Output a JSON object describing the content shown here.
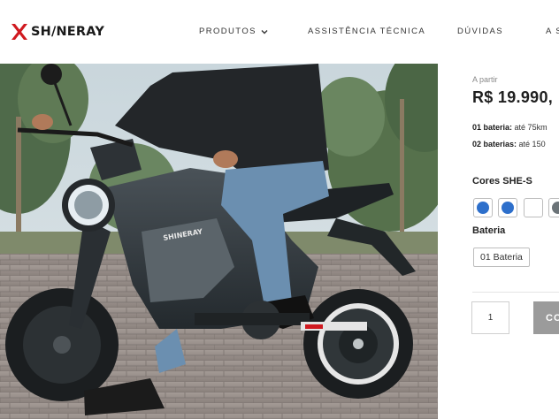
{
  "brand": {
    "logo_text": "SH/NERAY",
    "accent_color": "#d0191f"
  },
  "nav": {
    "items": [
      {
        "label": "PRODUTOS",
        "has_dropdown": true
      },
      {
        "label": "ASSISTÊNCIA TÉCNICA",
        "has_dropdown": false
      },
      {
        "label": "DÚVIDAS",
        "has_dropdown": false
      },
      {
        "label": "A S",
        "has_dropdown": false
      }
    ]
  },
  "hero": {
    "image_subject": "rider on SHINERAY SHE-S electric motorcycle",
    "bike_brand_text": "SHINERAY"
  },
  "product": {
    "from_label": "A partir",
    "price": "R$ 19.990,",
    "batteries": [
      {
        "label": "01 bateria:",
        "value": "até 75km"
      },
      {
        "label": "02 baterias:",
        "value": "até 150"
      }
    ],
    "colors_label": "Cores SHE-S",
    "colors": [
      {
        "name": "blue",
        "hex": "#2d6fcb"
      },
      {
        "name": "blue",
        "hex": "#2d6fcb"
      },
      {
        "name": "white",
        "hex": "#ffffff"
      },
      {
        "name": "gray",
        "hex": "#6b7378"
      }
    ],
    "battery_label": "Bateria",
    "battery_option": "01 Bateria",
    "quantity": "1",
    "buy_label": "CO"
  }
}
